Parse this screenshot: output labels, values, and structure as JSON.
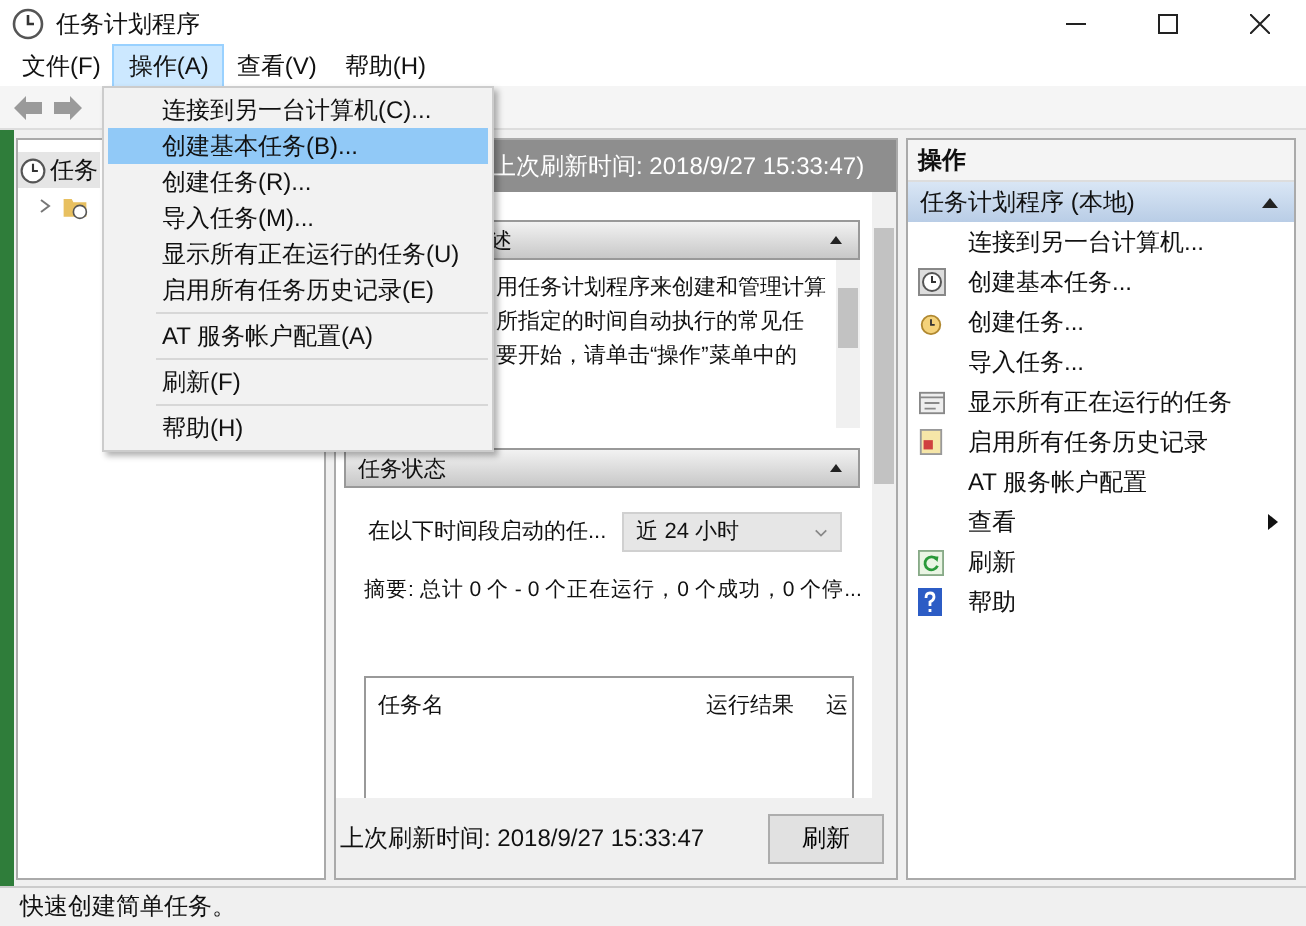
{
  "window": {
    "title": "任务计划程序"
  },
  "menu_bar": [
    {
      "label": "文件(F)",
      "selected": false
    },
    {
      "label": "操作(A)",
      "selected": true
    },
    {
      "label": "查看(V)",
      "selected": false
    },
    {
      "label": "帮助(H)",
      "selected": false
    }
  ],
  "menu": {
    "items": [
      {
        "kind": "item",
        "label": "连接到另一台计算机(C)...",
        "highlighted": false
      },
      {
        "kind": "item",
        "label": "创建基本任务(B)...",
        "highlighted": true
      },
      {
        "kind": "item",
        "label": "创建任务(R)...",
        "highlighted": false
      },
      {
        "kind": "item",
        "label": "导入任务(M)...",
        "highlighted": false
      },
      {
        "kind": "item",
        "label": "显示所有正在运行的任务(U)",
        "highlighted": false
      },
      {
        "kind": "item",
        "label": "启用所有任务历史记录(E)",
        "highlighted": false
      },
      {
        "kind": "separator"
      },
      {
        "kind": "item",
        "label": "AT 服务帐户配置(A)",
        "highlighted": false
      },
      {
        "kind": "separator"
      },
      {
        "kind": "item",
        "label": "刷新(F)",
        "highlighted": false
      },
      {
        "kind": "separator"
      },
      {
        "kind": "item",
        "label": "帮助(H)",
        "highlighted": false
      }
    ]
  },
  "tree": [
    {
      "label": "任务",
      "selected": true,
      "children": [
        {
          "selected": false,
          "expanded": false
        }
      ]
    }
  ],
  "summary": {
    "header": "上次刷新时间: 2018/9/27 15:33:47)",
    "overview": {
      "title": "述",
      "expanded": true,
      "lines": [
        "用任务计划程序来创建和管理计算",
        "所指定的时间自动执行的常见任",
        "要开始，请单击“操作”菜单中的"
      ]
    },
    "status": {
      "title": "任务状态",
      "expanded": true,
      "period_label": "在以下时间段启动的任...",
      "period_value": "近 24 小时",
      "summary": "摘要: 总计 0 个 - 0 个正在运行，0 个成功，0 个停...",
      "columns": [
        "任务名",
        "运行结果",
        "运"
      ]
    },
    "footer": {
      "last_refresh": "上次刷新时间: 2018/9/27 15:33:47",
      "refresh_button": "刷新"
    }
  },
  "actions": {
    "title": "操作",
    "section": {
      "title": "任务计划程序 (本地)",
      "expanded": true
    },
    "items": [
      {
        "label": "连接到另一台计算机...",
        "kind": "action"
      },
      {
        "label": "创建基本任务...",
        "kind": "action"
      },
      {
        "label": "创建任务...",
        "kind": "action"
      },
      {
        "label": "导入任务...",
        "kind": "action"
      },
      {
        "label": "显示所有正在运行的任务",
        "kind": "action"
      },
      {
        "label": "启用所有任务历史记录",
        "kind": "action"
      },
      {
        "label": "AT 服务帐户配置",
        "kind": "action"
      },
      {
        "label": "查看",
        "kind": "submenu"
      },
      {
        "label": "刷新",
        "kind": "action"
      },
      {
        "label": "帮助",
        "kind": "action"
      }
    ]
  },
  "status_bar": "快速创建简单任务。"
}
